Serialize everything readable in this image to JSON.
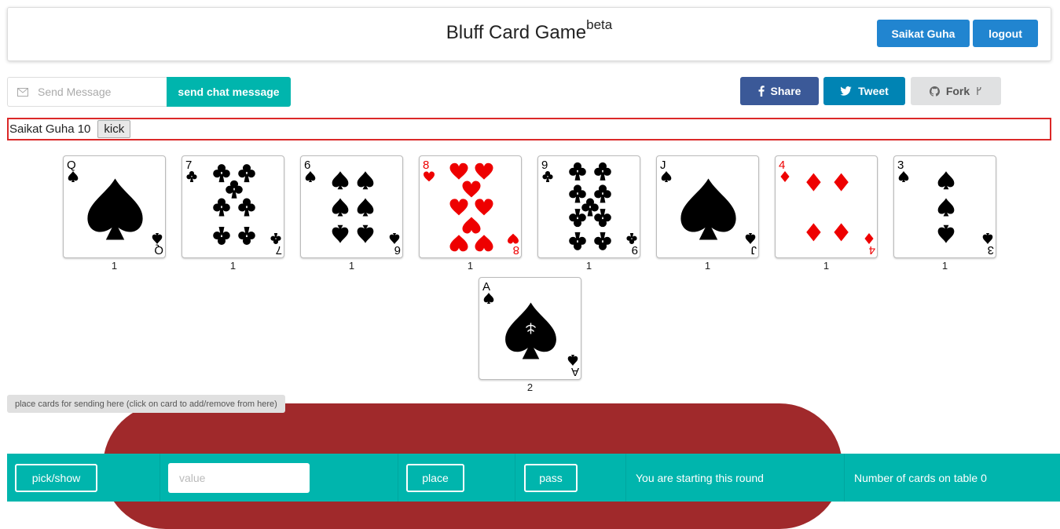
{
  "header": {
    "title": "Bluff Card Game",
    "title_sup": "beta",
    "user_button": "Saikat Guha",
    "logout_button": "logout"
  },
  "chat": {
    "placeholder": "Send Message",
    "send_button": "send chat message"
  },
  "social": {
    "share": "Share",
    "tweet": "Tweet",
    "fork": "Fork",
    "share_color": "#3b5998",
    "tweet_color": "#0084b4",
    "fork_color": "#e0e1e2"
  },
  "player": {
    "name_score": "Saikat Guha 10",
    "kick_button": "kick"
  },
  "hand": [
    {
      "rank": "Q",
      "suit": "spade",
      "count": "1"
    },
    {
      "rank": "7",
      "suit": "club",
      "count": "1"
    },
    {
      "rank": "6",
      "suit": "spade",
      "count": "1"
    },
    {
      "rank": "8",
      "suit": "heart",
      "count": "1"
    },
    {
      "rank": "9",
      "suit": "club",
      "count": "1"
    },
    {
      "rank": "J",
      "suit": "spade",
      "count": "1"
    },
    {
      "rank": "4",
      "suit": "diamond",
      "count": "1"
    },
    {
      "rank": "3",
      "suit": "spade",
      "count": "1"
    },
    {
      "rank": "A",
      "suit": "spade",
      "count": "2"
    }
  ],
  "placement_hint": "place cards for sending here (click on card to add/remove from here)",
  "bottom": {
    "pick_show": "pick/show",
    "value_placeholder": "value",
    "place": "place",
    "pass": "pass",
    "status": "You are starting this round",
    "table_count": "Number of cards on table 0"
  },
  "colors": {
    "primary": "#2185d0",
    "teal": "#00b5ad",
    "table": "#a0292b",
    "alert_border": "#db2828"
  }
}
